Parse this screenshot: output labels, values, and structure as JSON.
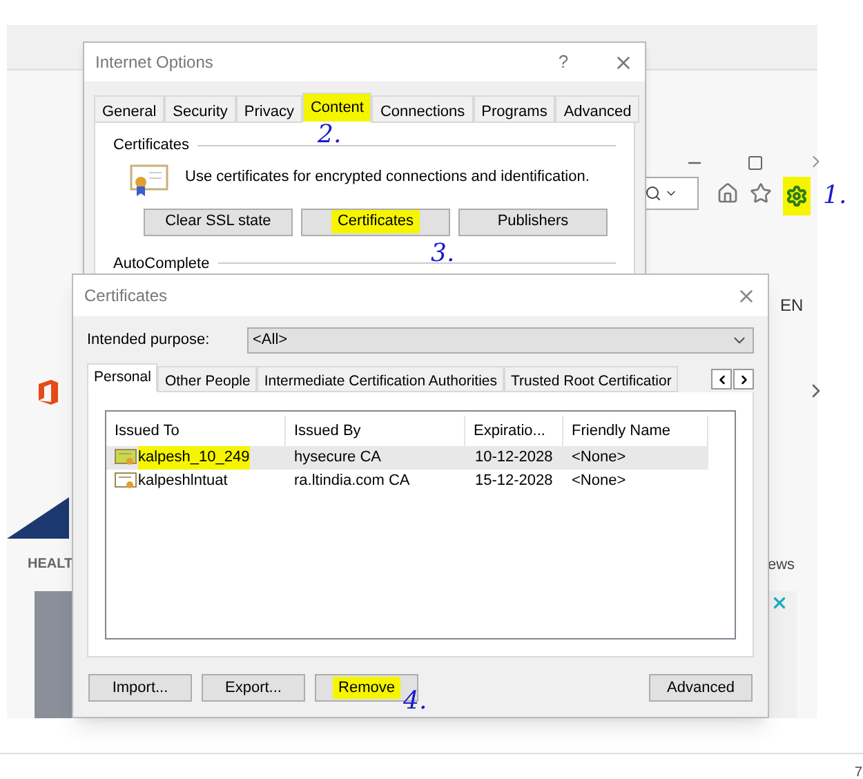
{
  "browser": {
    "language": "EN",
    "section_label": "HEALT",
    "section_label_2": "ews",
    "page_number": "7",
    "gear_highlighted": true
  },
  "annotations": [
    {
      "text": "1."
    },
    {
      "text": "2."
    },
    {
      "text": "3."
    },
    {
      "text": "4."
    }
  ],
  "internet_options": {
    "title": "Internet Options",
    "help": "?",
    "tabs": [
      {
        "label": "General",
        "selected": false,
        "highlighted": false
      },
      {
        "label": "Security",
        "selected": false,
        "highlighted": false
      },
      {
        "label": "Privacy",
        "selected": false,
        "highlighted": false
      },
      {
        "label": "Content",
        "selected": true,
        "highlighted": true
      },
      {
        "label": "Connections",
        "selected": false,
        "highlighted": false
      },
      {
        "label": "Programs",
        "selected": false,
        "highlighted": false
      },
      {
        "label": "Advanced",
        "selected": false,
        "highlighted": false
      }
    ],
    "certificates_group": {
      "label": "Certificates",
      "description": "Use certificates for encrypted connections and identification.",
      "buttons": [
        {
          "label": "Clear SSL state",
          "highlighted": false
        },
        {
          "label": "Certificates",
          "highlighted": true
        },
        {
          "label": "Publishers",
          "highlighted": false
        }
      ]
    },
    "autocomplete_label": "AutoComplete"
  },
  "certificates_dialog": {
    "title": "Certificates",
    "purpose_label": "Intended purpose:",
    "purpose_value": "<All>",
    "tabs": [
      {
        "label": "Personal",
        "selected": true
      },
      {
        "label": "Other People",
        "selected": false
      },
      {
        "label": "Intermediate Certification Authorities",
        "selected": false
      },
      {
        "label": "Trusted Root Certificatior",
        "selected": false
      }
    ],
    "columns": [
      "Issued To",
      "Issued By",
      "Expiratio...",
      "Friendly Name"
    ],
    "rows": [
      {
        "cells": [
          "kalpesh_10_249",
          "hysecure CA",
          "10-12-2028",
          "<None>"
        ],
        "selected": true,
        "highlighted": true
      },
      {
        "cells": [
          "kalpeshlntuat",
          "ra.ltindia.com CA",
          "15-12-2028",
          "<None>"
        ],
        "selected": false,
        "highlighted": false
      }
    ],
    "buttons": [
      {
        "label": "Import...",
        "highlighted": false
      },
      {
        "label": "Export...",
        "highlighted": false
      },
      {
        "label": "Remove",
        "highlighted": true
      },
      {
        "label": "Advanced",
        "highlighted": false
      }
    ]
  }
}
